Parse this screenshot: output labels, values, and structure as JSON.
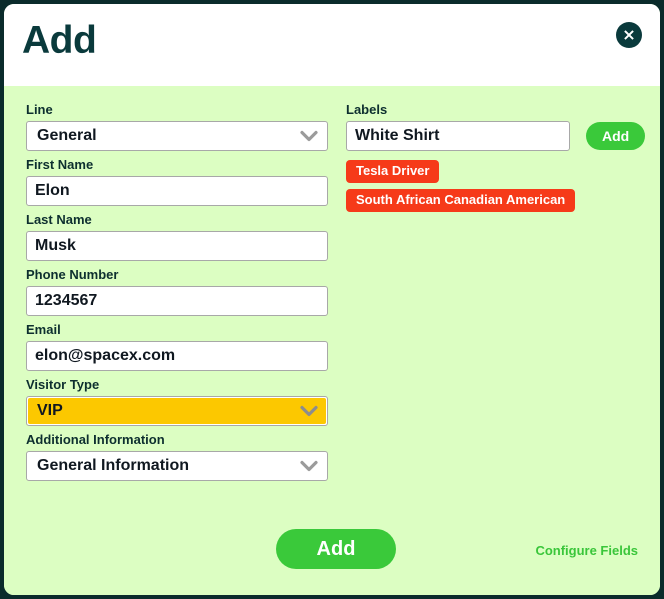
{
  "dialog": {
    "title": "Add",
    "close_icon": "close-circle-icon",
    "colors": {
      "border": "#0a2b2b",
      "header_bg": "#ffffff",
      "body_bg": "#dcfec2",
      "title": "#0a3a3c",
      "accent_green": "#3ac93a",
      "tag_red": "#f63a19",
      "amber": "#fcc800",
      "link_green": "#3ac63a"
    }
  },
  "form": {
    "fields": [
      {
        "label": "Line",
        "type": "select",
        "value": "General",
        "name": "line",
        "icon": "chevron-down-icon",
        "highlight": false
      },
      {
        "label": "First Name",
        "type": "text",
        "value": "Elon",
        "placeholder": "",
        "name": "first-name",
        "highlight": false
      },
      {
        "label": "Last Name",
        "type": "text",
        "value": "Musk",
        "placeholder": "",
        "name": "last-name",
        "highlight": false
      },
      {
        "label": "Phone Number",
        "type": "text",
        "value": "1234567",
        "placeholder": "",
        "name": "phone-number",
        "highlight": false
      },
      {
        "label": "Email",
        "type": "text",
        "value": "elon@spacex.com",
        "placeholder": "",
        "name": "email",
        "highlight": false
      },
      {
        "label": "Visitor Type",
        "type": "select",
        "value": "VIP",
        "name": "visitor-type",
        "icon": "chevron-down-icon",
        "highlight": true
      },
      {
        "label": "Additional Information",
        "type": "select",
        "value": "General Information",
        "name": "additional-information",
        "icon": "chevron-down-icon",
        "highlight": false
      }
    ]
  },
  "labels_section": {
    "label": "Labels",
    "input_value": "White Shirt",
    "input_placeholder": "",
    "add_label": "Add",
    "tags": [
      "Tesla Driver",
      "South African Canadian American"
    ]
  },
  "footer": {
    "submit_label": "Add",
    "configure_label": "Configure Fields"
  }
}
